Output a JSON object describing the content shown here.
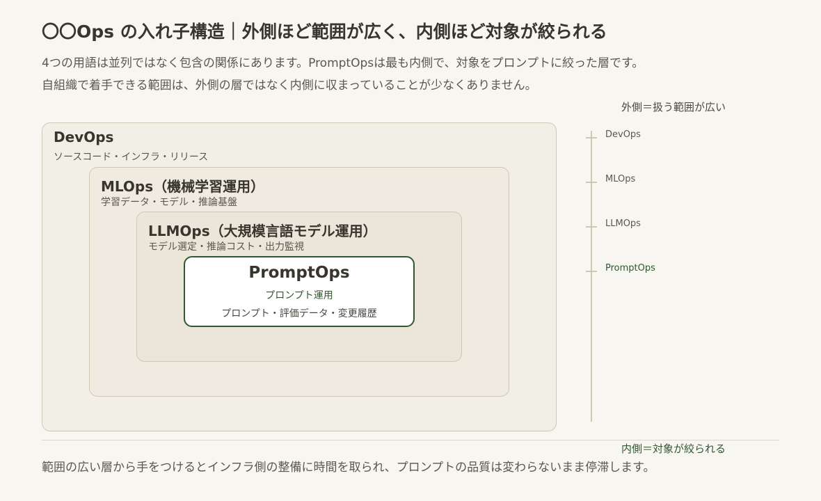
{
  "header": {
    "title": "〇〇Ops の入れ子構造｜外側ほど範囲が広く、内側ほど対象が絞られる",
    "subtitle_line1": "4つの用語は並列ではなく包含の関係にあります。PromptOpsは最も内側で、対象をプロンプトに絞った層です。",
    "subtitle_line2": "自組織で着手できる範囲は、外側の層ではなく内側に収まっていることが少なくありません。"
  },
  "layers": [
    {
      "name": "DevOps",
      "description": "ソースコード・インフラ・リリース"
    },
    {
      "name": "MLOps（機械学習運用）",
      "description": "学習データ・モデル・推論基盤"
    },
    {
      "name": "LLMOps（大規模言語モデル運用）",
      "description": "モデル選定・推論コスト・出力監視"
    },
    {
      "name": "PromptOps",
      "kind": "プロンプト運用",
      "description": "プロンプト・評価データ・変更履歴"
    }
  ],
  "scale": {
    "top_label": "外側＝扱う範囲が広い",
    "bottom_label": "内側＝対象が絞られる",
    "items": [
      "DevOps",
      "MLOps",
      "LLMOps",
      "PromptOps"
    ]
  },
  "footer": {
    "text": "範囲の広い層から手をつけるとインフラ側の整備に時間を取られ、プロンプトの品質は変わらないまま停滞します。"
  },
  "colors": {
    "background": "#f8f6f1",
    "accent_green": "#2f5730",
    "box_border": "#cfc8b4"
  }
}
